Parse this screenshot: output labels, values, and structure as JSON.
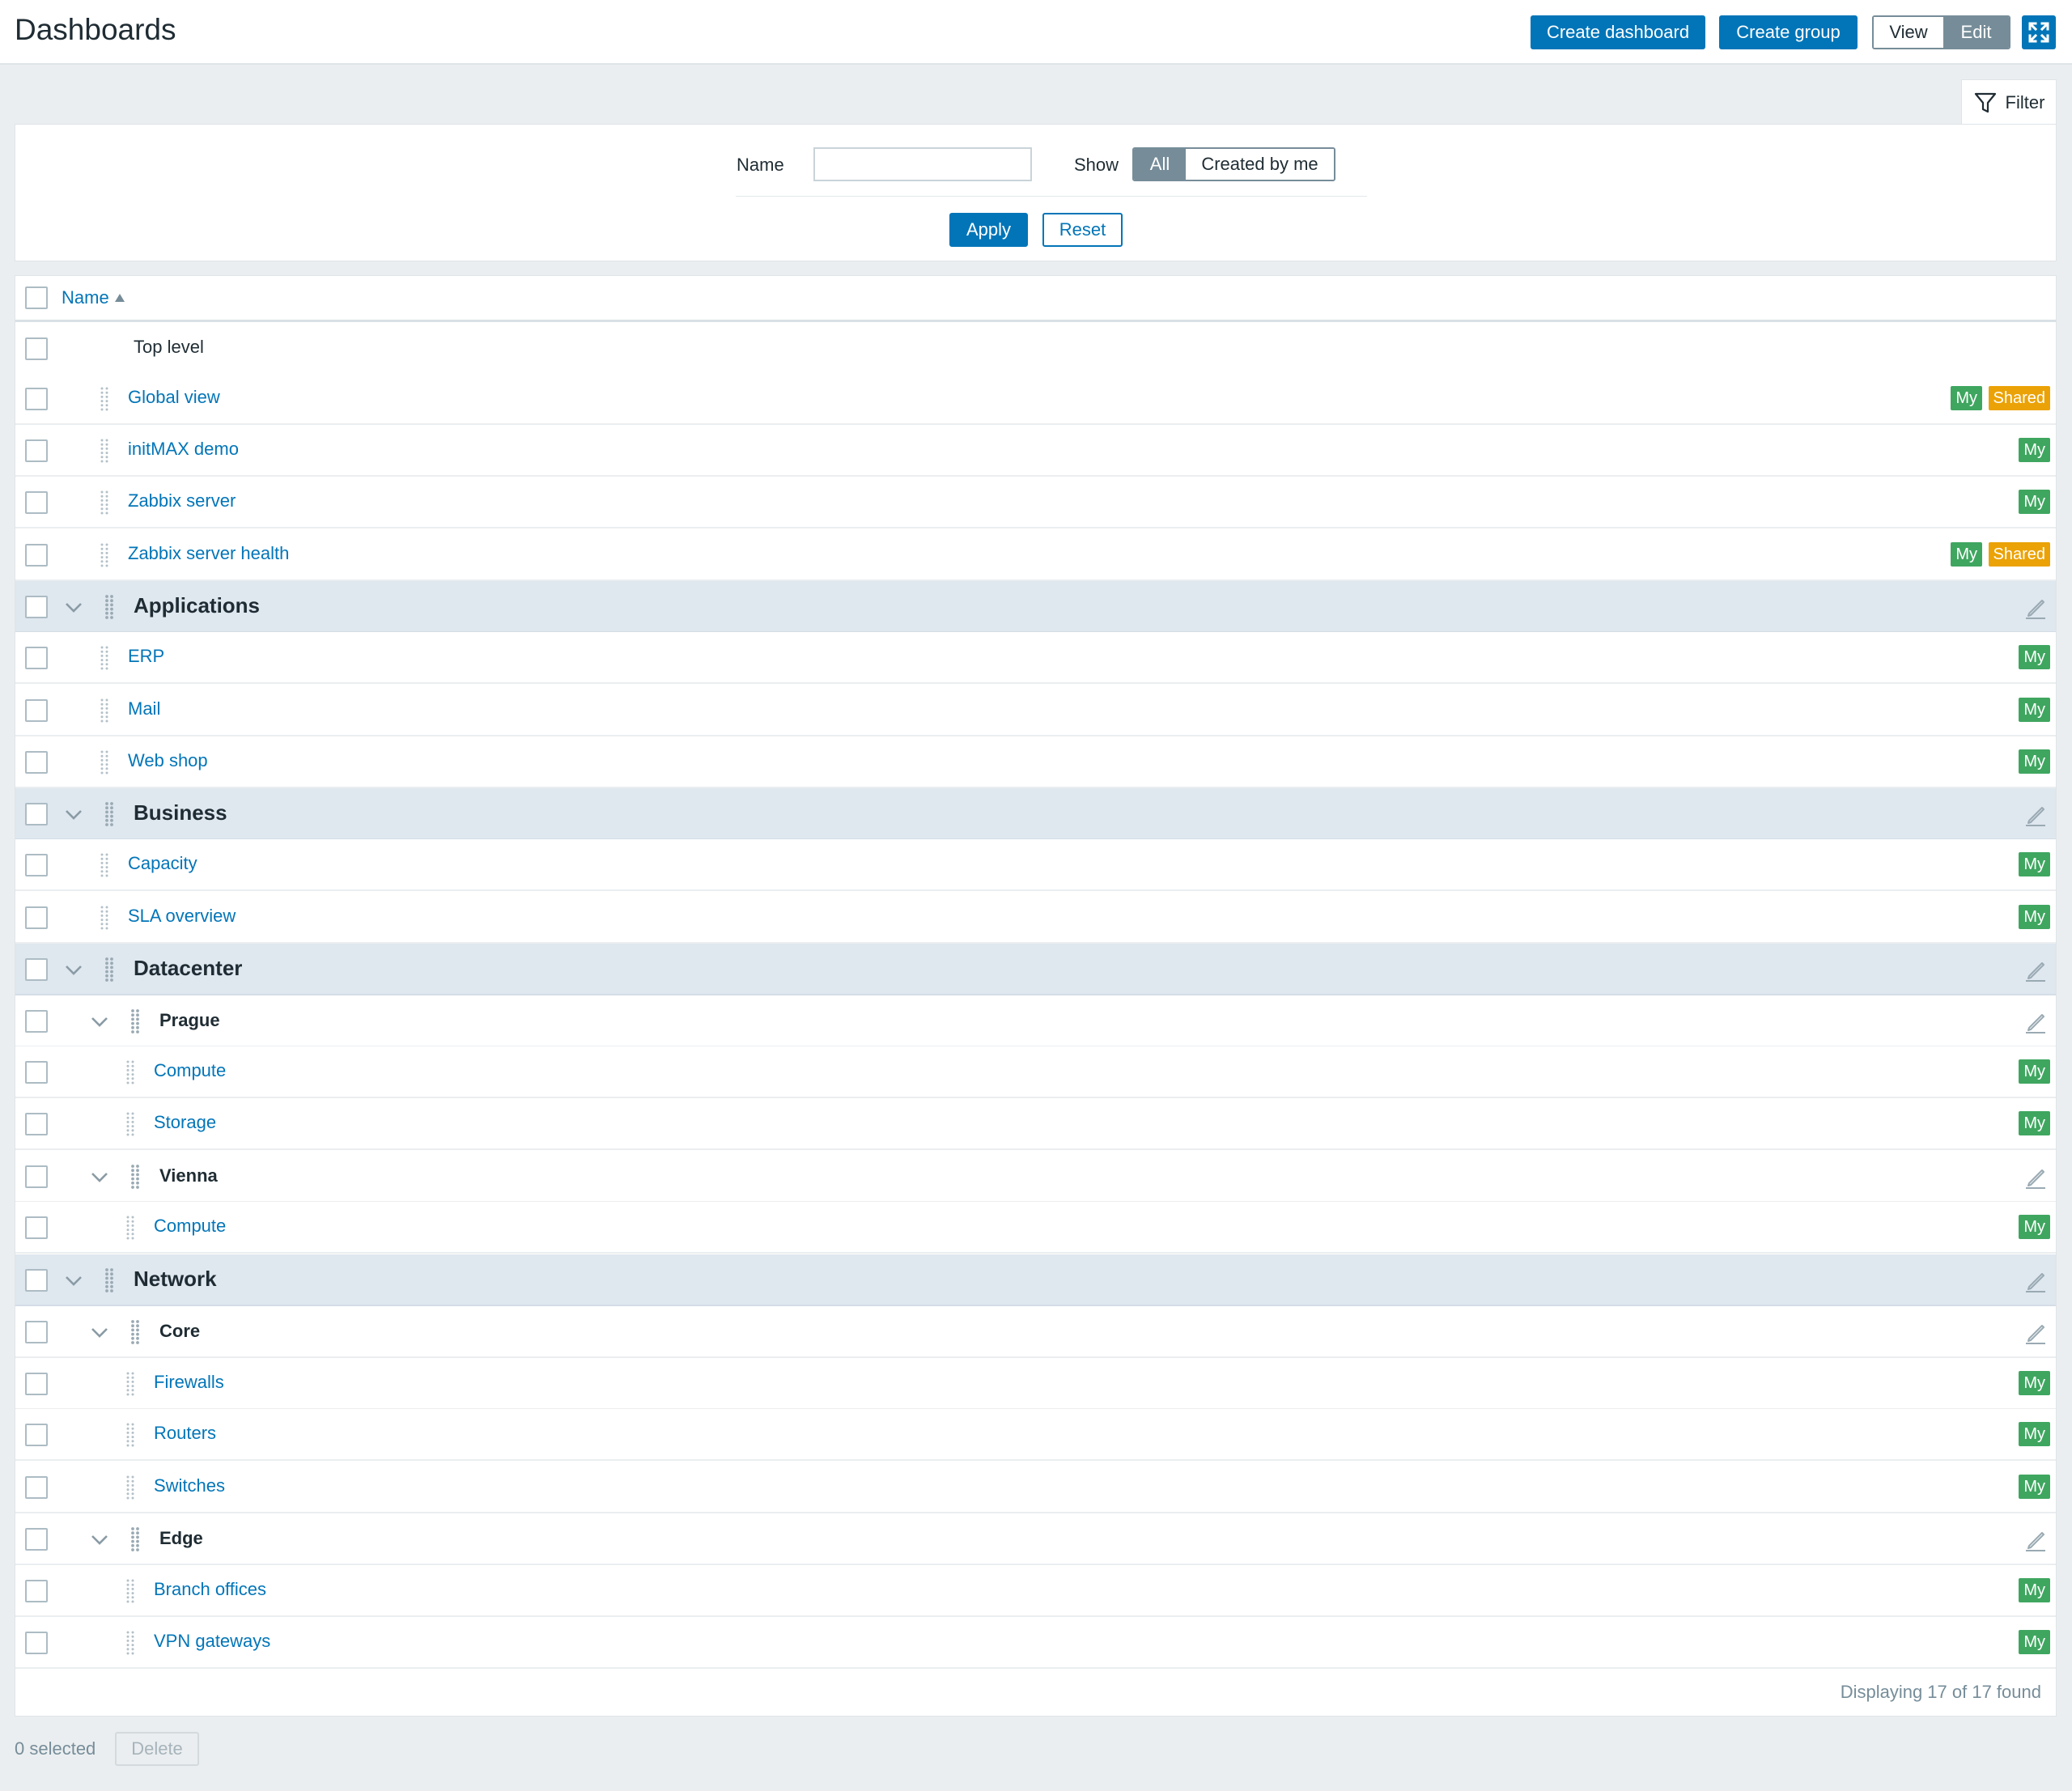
{
  "header": {
    "title": "Dashboards",
    "create_dashboard": "Create dashboard",
    "create_group": "Create group",
    "view": "View",
    "edit": "Edit"
  },
  "filter": {
    "tab_label": "Filter",
    "name_label": "Name",
    "name_value": "",
    "show_label": "Show",
    "show_options": [
      "All",
      "Created by me"
    ],
    "show_selected": "All",
    "apply": "Apply",
    "reset": "Reset"
  },
  "table": {
    "column_name": "Name",
    "rows": [
      {
        "type": "toplevel",
        "label": "Top level",
        "level": 0
      },
      {
        "type": "dashboard",
        "label": "Global view",
        "level": 0,
        "badges": [
          "My",
          "Shared"
        ]
      },
      {
        "type": "dashboard",
        "label": "initMAX demo",
        "level": 0,
        "badges": [
          "My"
        ]
      },
      {
        "type": "dashboard",
        "label": "Zabbix server",
        "level": 0,
        "badges": [
          "My"
        ]
      },
      {
        "type": "dashboard",
        "label": "Zabbix server health",
        "level": 0,
        "badges": [
          "My",
          "Shared"
        ]
      },
      {
        "type": "group",
        "label": "Applications",
        "level": 0
      },
      {
        "type": "dashboard",
        "label": "ERP",
        "level": 0,
        "badges": [
          "My"
        ]
      },
      {
        "type": "dashboard",
        "label": "Mail",
        "level": 0,
        "badges": [
          "My"
        ]
      },
      {
        "type": "dashboard",
        "label": "Web shop",
        "level": 0,
        "badges": [
          "My"
        ]
      },
      {
        "type": "group",
        "label": "Business",
        "level": 0
      },
      {
        "type": "dashboard",
        "label": "Capacity",
        "level": 0,
        "badges": [
          "My"
        ]
      },
      {
        "type": "dashboard",
        "label": "SLA overview",
        "level": 0,
        "badges": [
          "My"
        ]
      },
      {
        "type": "group",
        "label": "Datacenter",
        "level": 0
      },
      {
        "type": "subgroup",
        "label": "Prague",
        "level": 1
      },
      {
        "type": "dashboard",
        "label": "Compute",
        "level": 1,
        "badges": [
          "My"
        ]
      },
      {
        "type": "dashboard",
        "label": "Storage",
        "level": 1,
        "badges": [
          "My"
        ]
      },
      {
        "type": "subgroup",
        "label": "Vienna",
        "level": 1
      },
      {
        "type": "dashboard",
        "label": "Compute",
        "level": 1,
        "badges": [
          "My"
        ]
      },
      {
        "type": "group",
        "label": "Network",
        "level": 0
      },
      {
        "type": "subgroup",
        "label": "Core",
        "level": 1
      },
      {
        "type": "dashboard",
        "label": "Firewalls",
        "level": 1,
        "badges": [
          "My"
        ]
      },
      {
        "type": "dashboard",
        "label": "Routers",
        "level": 1,
        "badges": [
          "My"
        ]
      },
      {
        "type": "dashboard",
        "label": "Switches",
        "level": 1,
        "badges": [
          "My"
        ]
      },
      {
        "type": "subgroup",
        "label": "Edge",
        "level": 1
      },
      {
        "type": "dashboard",
        "label": "Branch offices",
        "level": 1,
        "badges": [
          "My"
        ]
      },
      {
        "type": "dashboard",
        "label": "VPN gateways",
        "level": 1,
        "badges": [
          "My"
        ]
      }
    ],
    "footer": "Displaying 17 of 17 found"
  },
  "bulk": {
    "selected": "0 selected",
    "delete": "Delete"
  },
  "colors": {
    "primary": "#0275b8",
    "badge_my": "#3fa660",
    "badge_shared": "#eba206",
    "group_row": "#dfe7ef"
  },
  "icons": {
    "fullscreen": "fullscreen-icon",
    "filter": "funnel-icon",
    "sort": "sort-asc-icon",
    "collapse": "chevron-down-icon",
    "drag": "drag-handle-icon",
    "edit": "pencil-icon"
  }
}
